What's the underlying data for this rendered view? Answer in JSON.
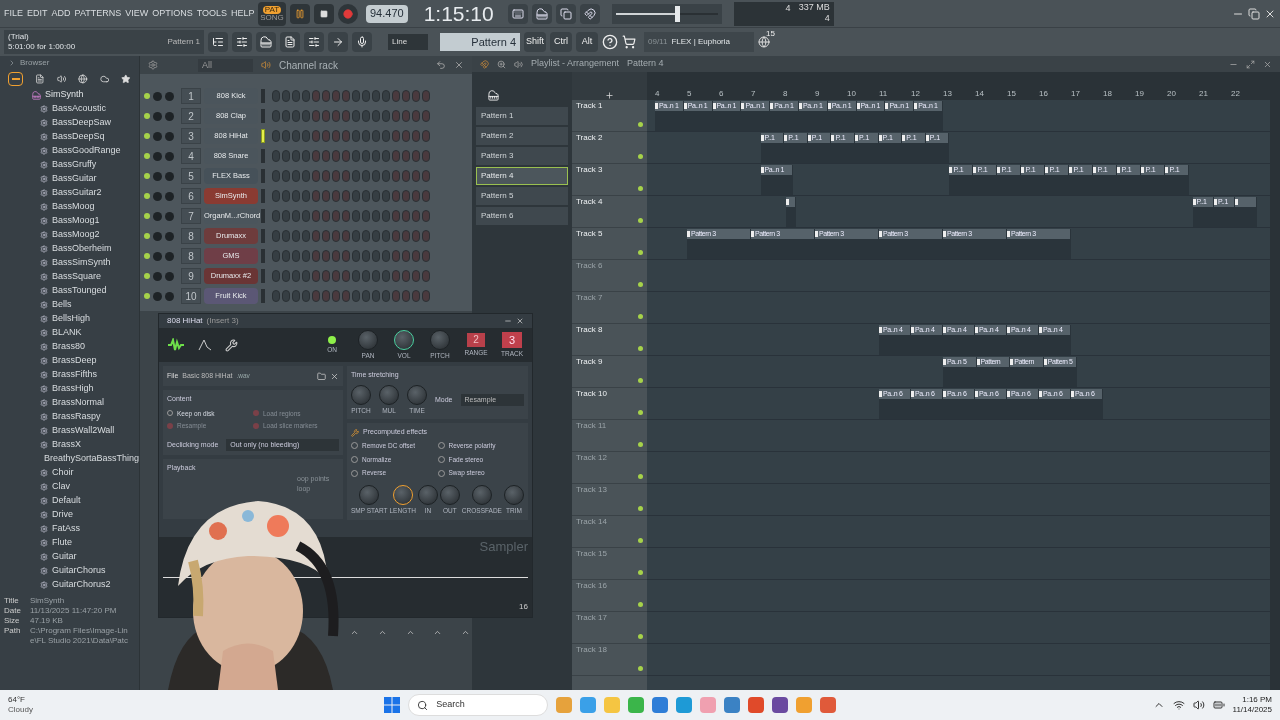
{
  "menu": [
    "FILE",
    "EDIT",
    "ADD",
    "PATTERNS",
    "VIEW",
    "OPTIONS",
    "TOOLS",
    "HELP"
  ],
  "transport": {
    "pat": "PAT",
    "song": "SONG",
    "pat_active": true,
    "tempo": "94.470",
    "time": "1:15:10"
  },
  "hint": {
    "line1": "(Trial)",
    "line2": "5:01:00 for 1:00:00",
    "pattern": "Pattern 1"
  },
  "master_volume": {
    "level": 0.6
  },
  "snap": "Line",
  "current_pattern": "Pattern 4",
  "modifiers": [
    "Shift",
    "Ctrl",
    "Alt"
  ],
  "news": {
    "date": "09/11",
    "title": "FLEX | Euphoria",
    "badge": "15"
  },
  "cpu": {
    "voices": "4",
    "memory": "337 MB",
    "polyphony": "4"
  },
  "browser": {
    "title": "Browser",
    "folder": "SimSynth",
    "items": [
      "BassAcoustic",
      "BassDeepSaw",
      "BassDeepSq",
      "BassGoodRange",
      "BassGruffy",
      "BassGuitar",
      "BassGuitar2",
      "BassMoog",
      "BassMoog1",
      "BassMoog2",
      "BassOberheim",
      "BassSimSynth",
      "BassSquare",
      "BassTounged",
      "Bells",
      "BellsHigh",
      "BLANK",
      "Brass80",
      "BrassDeep",
      "BrassFifths",
      "BrassHigh",
      "BrassNormal",
      "BrassRaspy",
      "BrassWall2Wall",
      "BrassX",
      "BreathySortaBassThing",
      "Choir",
      "Clav",
      "Default",
      "Drive",
      "FatAss",
      "Flute",
      "Guitar",
      "GuitarChorus",
      "GuitarChorus2"
    ],
    "info": [
      {
        "label": "Title",
        "value": "SimSynth"
      },
      {
        "label": "Date",
        "value": "11/13/2025 11:47:20 PM"
      },
      {
        "label": "Size",
        "value": "47.19 KB"
      },
      {
        "label": "Path",
        "value": "C:\\Program Files\\Image-Lin"
      },
      {
        "value": "e\\FL Studio 2021\\Data\\Patc"
      }
    ]
  },
  "channel_rack": {
    "filter": "All",
    "title": "Channel rack",
    "channels": [
      {
        "number": "1",
        "name": "808 Kick",
        "color": "#4b555c",
        "selected": false
      },
      {
        "number": "2",
        "name": "808 Clap",
        "color": "#4b555c",
        "selected": false
      },
      {
        "number": "3",
        "name": "808 HiHat",
        "color": "#4b555c",
        "selected": true
      },
      {
        "number": "4",
        "name": "808 Snare",
        "color": "#4b555c",
        "selected": false
      },
      {
        "number": "5",
        "name": "FLEX Bass",
        "color": "#465159",
        "selected": false
      },
      {
        "number": "6",
        "name": "SimSynth",
        "color": "#8a3b32",
        "selected": false
      },
      {
        "number": "7",
        "name": "OrganM...rChord",
        "color": "#4b555c",
        "selected": false
      },
      {
        "number": "8",
        "name": "Drumaxx",
        "color": "#6e3c3c",
        "selected": false
      },
      {
        "number": "8",
        "name": "GMS",
        "color": "#6f3e47",
        "selected": false
      },
      {
        "number": "9",
        "name": "Drumaxx #2",
        "color": "#6a3535",
        "selected": false
      },
      {
        "number": "10",
        "name": "Fruit Kick",
        "color": "#5b5775",
        "selected": false
      }
    ]
  },
  "sampler": {
    "title": "808 HiHat",
    "insert": "(Insert 3)",
    "top_knobs": [
      "ON",
      "PAN",
      "VOL",
      "PITCH",
      "RANGE",
      "TRACK"
    ],
    "range": "2",
    "track": "3",
    "file_label": "File",
    "file": "Basic 808 HiHat",
    "ext": ".wav",
    "time_stretching": {
      "title": "Time stretching",
      "knobs": [
        "PITCH",
        "MUL",
        "TIME"
      ],
      "mode_label": "Mode",
      "mode": "Resample"
    },
    "content": {
      "title": "Content",
      "options": [
        {
          "label": "Keep on disk",
          "disabled": false
        },
        {
          "label": "Load regions",
          "disabled": true
        },
        {
          "label": "Resample",
          "disabled": true
        },
        {
          "label": "Load slice markers",
          "disabled": true
        }
      ],
      "declick_label": "Declicking mode",
      "declick": "Out only (no bleeding)"
    },
    "effects": {
      "title": "Precomputed effects",
      "options": [
        "Remove DC offset",
        "Reverse polarity",
        "Normalize",
        "Fade stereo",
        "Reverse",
        "Swap stereo"
      ]
    },
    "playback": {
      "title": "Playback",
      "options": [
        "oop points",
        "loop"
      ]
    },
    "bottom_knobs": [
      "SMP START",
      "LENGTH",
      "IN",
      "OUT",
      "CROSSFADE",
      "TRIM"
    ],
    "brand": "Sampler",
    "count": "16"
  },
  "playlist": {
    "title": "Playlist - Arrangement",
    "pattern": "Pattern 4",
    "patterns": [
      {
        "name": "Pattern 1",
        "selected": false
      },
      {
        "name": "Pattern 2",
        "selected": false
      },
      {
        "name": "Pattern 3",
        "selected": false
      },
      {
        "name": "Pattern 4",
        "selected": true
      },
      {
        "name": "Pattern 5",
        "selected": false
      },
      {
        "name": "Pattern 6",
        "selected": false
      }
    ],
    "ruler": [
      "4",
      "5",
      "6",
      "7",
      "8",
      "9",
      "10",
      "11",
      "12",
      "13",
      "14",
      "15",
      "16",
      "17",
      "18",
      "19",
      "20",
      "21",
      "22"
    ],
    "tracks": [
      {
        "name": "Track 1",
        "active": true,
        "regions": [
          {
            "clips": [
              {
                "kind": "labelled",
                "label": "Pa..n 1"
              },
              {
                "kind": "labelled",
                "label": "Pa..n 1"
              },
              {
                "kind": "labelled",
                "label": "Pa..n 1"
              },
              {
                "kind": "labelled",
                "label": "Pa..n 1"
              },
              {
                "kind": "labelled",
                "label": "Pa..n 1"
              },
              {
                "kind": "labelled",
                "label": "Pa..n 1"
              },
              {
                "kind": "labelled",
                "label": "Pa..n 1"
              },
              {
                "kind": "labelled",
                "label": "Pa..n 1"
              },
              {
                "kind": "labelled",
                "label": "Pa..n 1"
              },
              {
                "kind": "labelled",
                "label": "Pa..n 1"
              }
            ]
          }
        ]
      },
      {
        "name": "Track 2",
        "active": true,
        "regions": [
          {
            "clips": [
              {
                "kind": "labelled",
                "label": "P..1"
              },
              {
                "kind": "labelled",
                "label": "P..1"
              },
              {
                "kind": "labelled",
                "label": "P..1"
              },
              {
                "kind": "labelled",
                "label": "P..1"
              },
              {
                "kind": "labelled",
                "label": "P..1"
              },
              {
                "kind": "labelled",
                "label": "P..1"
              },
              {
                "kind": "labelled",
                "label": "P..1"
              },
              {
                "kind": "labelled",
                "label": "P..1"
              }
            ]
          }
        ]
      },
      {
        "name": "Track 3",
        "active": true,
        "regions": [
          {
            "clips": [
              {
                "kind": "labelled",
                "label": "Pa..n 1"
              }
            ]
          },
          {
            "clips": [
              {
                "kind": "labelled",
                "label": "P..1"
              },
              {
                "kind": "labelled",
                "label": "P..1"
              },
              {
                "kind": "labelled",
                "label": "P..1"
              },
              {
                "kind": "labelled",
                "label": "P..1"
              },
              {
                "kind": "labelled",
                "label": "P..1"
              },
              {
                "kind": "labelled",
                "label": "P..1"
              },
              {
                "kind": "labelled",
                "label": "P..1"
              },
              {
                "kind": "labelled",
                "label": "P..1"
              },
              {
                "kind": "labelled",
                "label": "P..1"
              },
              {
                "kind": "labelled",
                "label": "P..1"
              }
            ]
          }
        ]
      },
      {
        "name": "Track 4",
        "active": true,
        "regions": [
          {
            "clips": [
              {
                "kind": "icon_only"
              }
            ]
          },
          {
            "clips": [
              {
                "kind": "labelled",
                "label": "P..1"
              },
              {
                "kind": "labelled",
                "label": "P..1"
              },
              {
                "kind": "icon_only"
              }
            ]
          }
        ]
      },
      {
        "name": "Track 5",
        "active": true,
        "regions": [
          {
            "clips": [
              {
                "kind": "labelled",
                "label": "Pattern 3"
              },
              {
                "kind": "labelled",
                "label": "Pattern 3"
              },
              {
                "kind": "labelled",
                "label": "Pattern 3"
              },
              {
                "kind": "labelled",
                "label": "Pattern 3"
              },
              {
                "kind": "labelled",
                "label": "Pattern 3"
              },
              {
                "kind": "labelled",
                "label": "Pattern 3"
              }
            ]
          }
        ]
      },
      {
        "name": "Track 6",
        "active": false
      },
      {
        "name": "Track 7",
        "active": false
      },
      {
        "name": "Track 8",
        "active": true,
        "regions": [
          {
            "clips": [
              {
                "kind": "labelled",
                "label": "Pa..n 4"
              },
              {
                "kind": "labelled",
                "label": "Pa..n 4"
              },
              {
                "kind": "labelled",
                "label": "Pa..n 4"
              },
              {
                "kind": "labelled",
                "label": "Pa..n 4"
              },
              {
                "kind": "labelled",
                "label": "Pa..n 4"
              },
              {
                "kind": "labelled",
                "label": "Pa..n 4"
              }
            ]
          }
        ]
      },
      {
        "name": "Track 9",
        "active": true,
        "regions": [
          {
            "clips": [
              {
                "kind": "labelled",
                "label": "Pa..n 5"
              },
              {
                "kind": "labelled",
                "label": "Pattern"
              },
              {
                "kind": "labelled",
                "label": "Pattern"
              },
              {
                "kind": "labelled",
                "label": "Pattern 5"
              }
            ]
          }
        ]
      },
      {
        "name": "Track 10",
        "active": true,
        "regions": [
          {
            "clips": [
              {
                "kind": "labelled",
                "label": "Pa..n 6"
              },
              {
                "kind": "labelled",
                "label": "Pa..n 6"
              },
              {
                "kind": "labelled",
                "label": "Pa..n 6"
              },
              {
                "kind": "labelled",
                "label": "Pa..n 6"
              },
              {
                "kind": "labelled",
                "label": "Pa..n 6"
              },
              {
                "kind": "labelled",
                "label": "Pa..n 6"
              },
              {
                "kind": "labelled",
                "label": "Pa..n 6"
              }
            ]
          }
        ]
      },
      {
        "name": "Track 11",
        "active": false
      },
      {
        "name": "Track 12",
        "active": false
      },
      {
        "name": "Track 13",
        "active": false
      },
      {
        "name": "Track 14",
        "active": false
      },
      {
        "name": "Track 15",
        "active": false
      },
      {
        "name": "Track 16",
        "active": false
      },
      {
        "name": "Track 17",
        "active": false
      },
      {
        "name": "Track 18",
        "active": false
      }
    ]
  },
  "taskbar": {
    "temperature": "64°F",
    "weather": "Cloudy",
    "search": "Search",
    "time": "1:16 PM",
    "date": "11/14/2025"
  }
}
